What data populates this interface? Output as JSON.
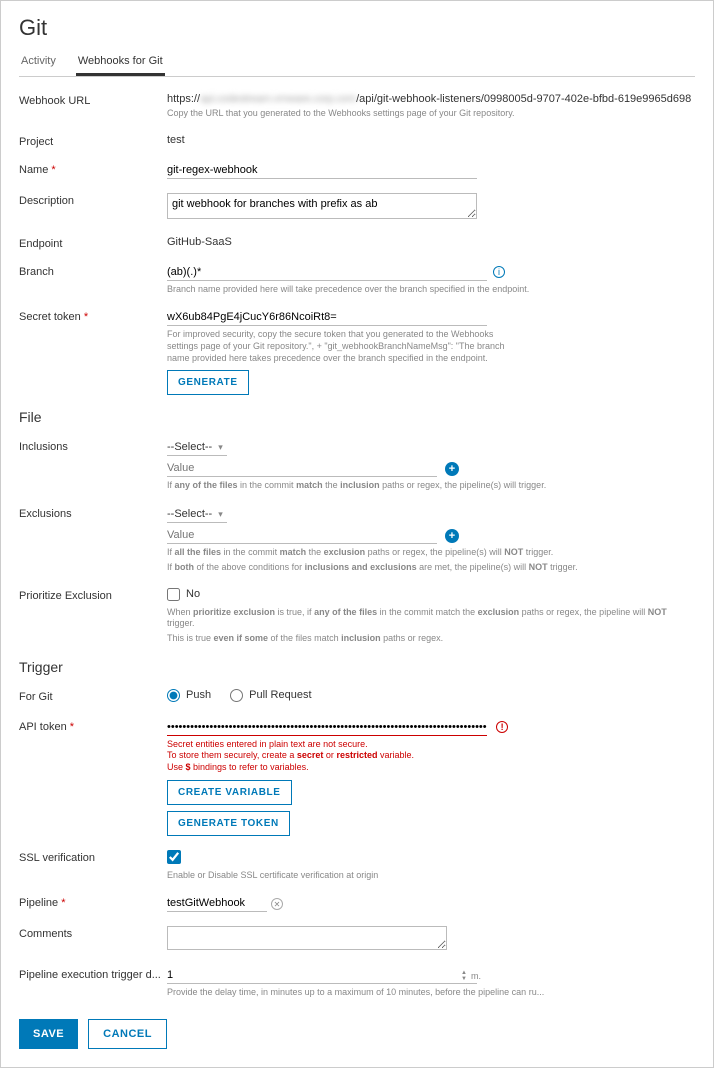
{
  "page": {
    "title": "Git"
  },
  "tabs": {
    "activity": "Activity",
    "webhooks": "Webhooks for Git"
  },
  "labels": {
    "webhook_url": "Webhook URL",
    "project": "Project",
    "name": "Name",
    "description": "Description",
    "endpoint": "Endpoint",
    "branch": "Branch",
    "secret_token": "Secret token",
    "inclusions": "Inclusions",
    "exclusions": "Exclusions",
    "prioritize_exclusion": "Prioritize Exclusion",
    "for_git": "For Git",
    "api_token": "API token",
    "ssl_verification": "SSL verification",
    "pipeline": "Pipeline",
    "comments": "Comments",
    "pipeline_delay": "Pipeline execution trigger d..."
  },
  "sections": {
    "file": "File",
    "trigger": "Trigger"
  },
  "webhook_url": {
    "prefix": "https://",
    "blurred": "api.codestream.vmware.corp.com",
    "suffix": "/api/git-webhook-listeners/0998005d-9707-402e-bfbd-619e9965d698",
    "hint": "Copy the URL that you generated to the Webhooks settings page of your Git repository."
  },
  "project": "test",
  "name": "git-regex-webhook",
  "description": "git webhook for branches with prefix as ab",
  "endpoint": "GitHub-SaaS",
  "branch": {
    "value": "(ab)(.)*",
    "hint": "Branch name provided here will take precedence over the branch specified in the endpoint."
  },
  "secret_token": {
    "value": "wX6ub84PgE4jCucY6r86NcoiRt8=",
    "hint": "For improved security, copy the secure token that you generated to the Webhooks settings page of your Git repository.\", + \"git_webhookBranchNameMsg\": \"The branch name provided here takes precedence over the branch specified in the endpoint.",
    "button": "GENERATE"
  },
  "file": {
    "select_placeholder": "--Select--",
    "value_placeholder": "Value",
    "inclusions_hint_pre": "If ",
    "inclusions_hint_any": "any of the files",
    "inclusions_hint_mid": " in the commit ",
    "inclusions_hint_match": "match",
    "inclusions_hint_the": " the ",
    "inclusions_hint_incl": "inclusion",
    "inclusions_hint_post": " paths or regex, the pipeline(s) will trigger.",
    "excl_hint1_pre": "If ",
    "excl_hint1_all": "all the files",
    "excl_hint1_mid": " in the commit ",
    "excl_hint1_match": "match",
    "excl_hint1_the": " the ",
    "excl_hint1_excl": "exclusion",
    "excl_hint1_post1": " paths or regex, the pipeline(s) will ",
    "excl_hint1_not": "NOT",
    "excl_hint1_post2": " trigger.",
    "excl_hint2_pre": "If ",
    "excl_hint2_both": "both",
    "excl_hint2_mid1": " of the above conditions for ",
    "excl_hint2_ie": "inclusions and exclusions",
    "excl_hint2_mid2": " are met, the pipeline(s) will ",
    "excl_hint2_not": "NOT",
    "excl_hint2_post": " trigger.",
    "prioritize_no": "No",
    "prio_hint1_pre": "When ",
    "prio_hint1_pe": "prioritize exclusion",
    "prio_hint1_mid1": " is true, if ",
    "prio_hint1_any": "any of the files",
    "prio_hint1_mid2": " in the commit match the ",
    "prio_hint1_excl": "exclusion",
    "prio_hint1_post1": " paths or regex, the pipeline will ",
    "prio_hint1_not": "NOT",
    "prio_hint1_post2": " trigger.",
    "prio_hint2_pre": "This is true ",
    "prio_hint2_even": "even if some",
    "prio_hint2_mid": " of the files match ",
    "prio_hint2_incl": "inclusion",
    "prio_hint2_post": " paths or regex."
  },
  "trigger": {
    "push": "Push",
    "pull_request": "Pull Request",
    "api_token_value": "••••••••••••••••••••••••••••••••••••••••••••••••••••••••••••••••••••••••••••••••••••••••••",
    "api_warn_l1": "Secret entities entered in plain text are not secure.",
    "api_warn_l2_pre": "To store them securely, create a ",
    "api_warn_l2_secret": "secret",
    "api_warn_l2_or": " or ",
    "api_warn_l2_restricted": "restricted",
    "api_warn_l2_post": " variable.",
    "api_warn_l3_pre": "Use ",
    "api_warn_l3_dollar": "$",
    "api_warn_l3_post": " bindings to refer to variables.",
    "create_variable": "CREATE VARIABLE",
    "generate_token": "GENERATE TOKEN",
    "ssl_hint": "Enable or Disable SSL certificate verification at origin",
    "pipeline_value": "testGitWebhook",
    "delay_value": "1",
    "delay_suffix": "m.",
    "delay_hint": "Provide the delay time, in minutes up to a maximum of 10 minutes, before the pipeline can ru..."
  },
  "footer": {
    "save": "SAVE",
    "cancel": "CANCEL"
  }
}
